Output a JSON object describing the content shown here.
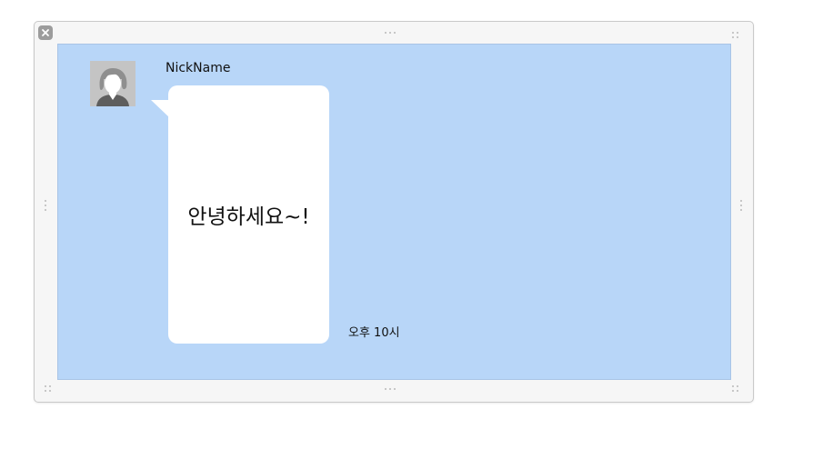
{
  "chat": {
    "nickname": "NickName",
    "message": "안녕하세요~!",
    "time": "오후 10시"
  },
  "icons": {
    "close": "close-icon",
    "avatar": "avatar-placeholder-icon"
  },
  "colors": {
    "chat_background": "#b8d6f8",
    "bubble": "#ffffff",
    "frame": "#f6f6f6"
  }
}
